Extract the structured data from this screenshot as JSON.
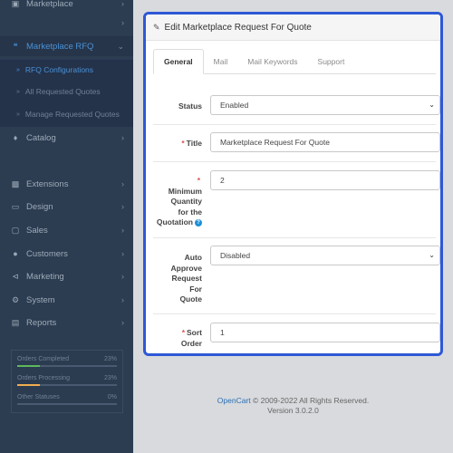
{
  "sidebar": {
    "items": [
      {
        "label": "Marketplace",
        "icon": "marketplace-icon"
      },
      {
        "label": "",
        "icon": ""
      },
      {
        "label": "Marketplace RFQ",
        "icon": "quote-icon"
      },
      {
        "label": "Catalog",
        "icon": "tag-icon"
      },
      {
        "label": "Extensions",
        "icon": "puzzle-icon"
      },
      {
        "label": "Design",
        "icon": "monitor-icon"
      },
      {
        "label": "Sales",
        "icon": "cart-icon"
      },
      {
        "label": "Customers",
        "icon": "user-icon"
      },
      {
        "label": "Marketing",
        "icon": "share-icon"
      },
      {
        "label": "System",
        "icon": "gear-icon"
      },
      {
        "label": "Reports",
        "icon": "bar-chart-icon"
      }
    ],
    "sub_items": [
      {
        "label": "RFQ Configurations"
      },
      {
        "label": "All Requested Quotes"
      },
      {
        "label": "Manage Requested Quotes"
      }
    ],
    "stats": [
      {
        "name": "Orders Completed",
        "pct": "23%",
        "value": 0.23,
        "color": "#5cb85c"
      },
      {
        "name": "Orders Processing",
        "pct": "23%",
        "value": 0.23,
        "color": "#f0ad4e"
      },
      {
        "name": "Other Statuses",
        "pct": "0%",
        "value": 0,
        "color": "#d9534f"
      }
    ]
  },
  "panel": {
    "title": "Edit Marketplace Request For Quote",
    "tabs": [
      "General",
      "Mail",
      "Mail Keywords",
      "Support"
    ],
    "fields": {
      "status": {
        "label": "Status",
        "value": "Enabled"
      },
      "title": {
        "label": "Title",
        "value": "Marketplace Request For Quote"
      },
      "min_qty": {
        "label_lines": [
          "Minimum",
          "Quantity",
          "for the",
          "Quotation"
        ],
        "value": "2"
      },
      "auto_approve": {
        "label_lines": [
          "Auto",
          "Approve",
          "Request",
          "For",
          "Quote"
        ],
        "value": "Disabled"
      },
      "sort_order": {
        "label_lines": [
          "Sort",
          "Order"
        ],
        "value": "1"
      }
    }
  },
  "footer": {
    "link": "OpenCart",
    "copyright": " © 2009-2022 All Rights Reserved.",
    "version": "Version 3.0.2.0"
  }
}
